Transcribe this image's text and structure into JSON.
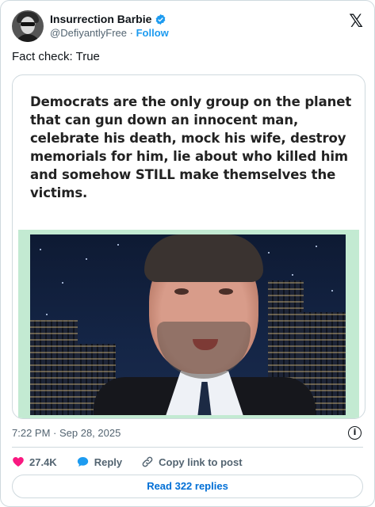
{
  "author": {
    "display_name": "Insurrection Barbie",
    "handle": "@DefiyantlyFree",
    "separator": "·",
    "follow_label": "Follow"
  },
  "tweet": {
    "text": "Fact check: True",
    "meme_text": "Democrats are the only group on the planet that can gun down an innocent man, celebrate his death, mock his wife, destroy memorials for him, lie about who killed him and somehow STILL make themselves the victims.",
    "timestamp": "7:22 PM · Sep 28, 2025"
  },
  "actions": {
    "likes": "27.4K",
    "reply_label": "Reply",
    "copy_label": "Copy link to post"
  },
  "read_replies_label": "Read 322 replies",
  "icons": {
    "x_logo": "𝕏",
    "info": "i"
  },
  "colors": {
    "accent": "#1d9bf0",
    "like": "#f91880",
    "photo_frame": "#c3ead2"
  }
}
